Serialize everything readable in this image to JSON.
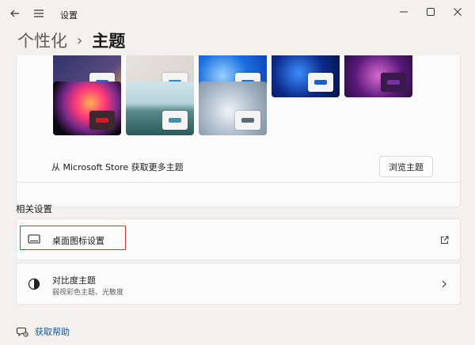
{
  "window": {
    "title": "设置"
  },
  "breadcrumb": {
    "parent": "个性化",
    "separator": "›",
    "current": "主题"
  },
  "themes": {
    "store_text": "从 Microsoft Store 获取更多主题",
    "browse_label": "浏览主题",
    "accent_colors": [
      "#1e6fd6",
      "#2b8ad8",
      "#1e6fd6",
      "#1a5fd0",
      "#7b2fa8",
      "#d01a2a",
      "#4a8fa8",
      "#5a6a78"
    ]
  },
  "related": {
    "heading": "相关设置",
    "desktop_icons_label": "桌面图标设置",
    "contrast_title": "对比度主题",
    "contrast_sub": "弱视彩色主题、光敏度"
  },
  "help": {
    "label": "获取帮助"
  },
  "colors": {
    "accent_link": "#0b5cad",
    "highlight_box": "#d9333a"
  }
}
